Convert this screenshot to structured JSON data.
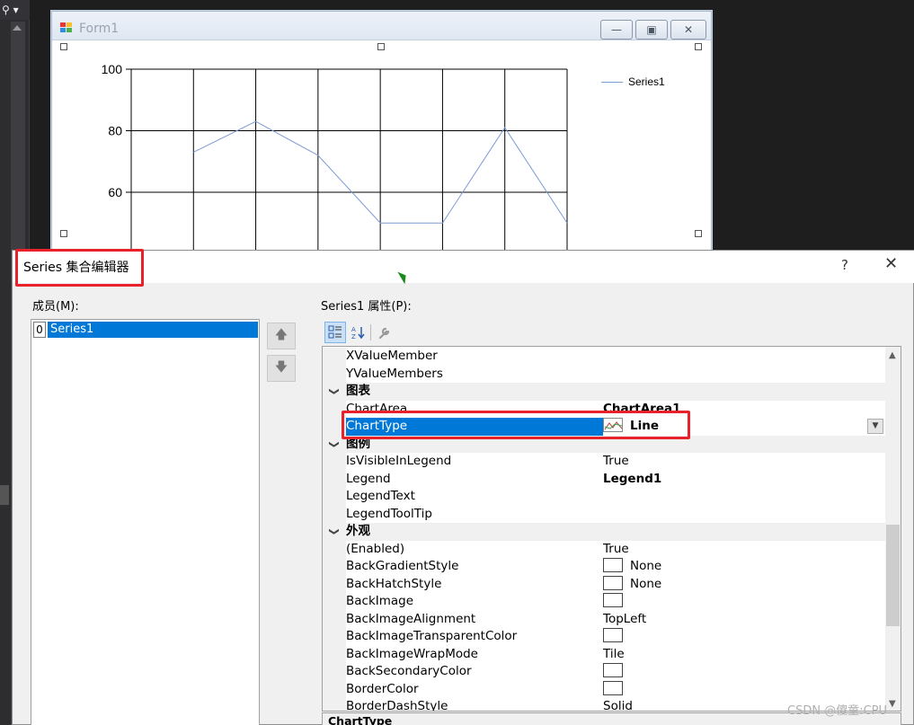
{
  "ide": {
    "top_button": "⚲ ▾"
  },
  "form": {
    "title": "Form1",
    "chart": {
      "y_ticks": [
        "100",
        "80",
        "60"
      ],
      "legend": "Series1"
    }
  },
  "chart_data": {
    "type": "line",
    "series": [
      {
        "name": "Series1",
        "color": "#7d9ad6",
        "values": [
          73,
          83,
          72,
          50,
          50,
          81,
          50
        ]
      }
    ],
    "ylim": [
      50,
      100
    ],
    "grid": true,
    "legend": "top-right"
  },
  "dialog": {
    "title": "Series 集合编辑器",
    "help": "?",
    "close": "✕",
    "members_label": "成员(M):",
    "members": [
      {
        "index": "0",
        "name": "Series1"
      }
    ],
    "move_up": "🡅",
    "move_down": "🡇",
    "props_label": "Series1 属性(P):",
    "toolbar": {
      "categorized": "categorized-icon",
      "alphabetical": "sort-az-icon",
      "property_pages": "wrench-icon"
    },
    "rows": [
      {
        "kind": "prop",
        "name": "XValueMember",
        "value": ""
      },
      {
        "kind": "prop",
        "name": "YValueMembers",
        "value": ""
      },
      {
        "kind": "cat",
        "name": "图表"
      },
      {
        "kind": "prop",
        "name": "ChartArea",
        "value": "ChartArea1",
        "bold": true
      },
      {
        "kind": "prop",
        "name": "ChartType",
        "value": "Line",
        "bold": true,
        "selected": true,
        "icon": "line"
      },
      {
        "kind": "cat",
        "name": "图例"
      },
      {
        "kind": "prop",
        "name": "IsVisibleInLegend",
        "value": "True"
      },
      {
        "kind": "prop",
        "name": "Legend",
        "value": "Legend1",
        "bold": true
      },
      {
        "kind": "prop",
        "name": "LegendText",
        "value": ""
      },
      {
        "kind": "prop",
        "name": "LegendToolTip",
        "value": ""
      },
      {
        "kind": "cat",
        "name": "外观"
      },
      {
        "kind": "prop",
        "name": "(Enabled)",
        "value": "True"
      },
      {
        "kind": "prop",
        "name": "BackGradientStyle",
        "value": "None",
        "icon": "swatch"
      },
      {
        "kind": "prop",
        "name": "BackHatchStyle",
        "value": "None",
        "icon": "swatch"
      },
      {
        "kind": "prop",
        "name": "BackImage",
        "value": "",
        "icon": "swatch"
      },
      {
        "kind": "prop",
        "name": "BackImageAlignment",
        "value": "TopLeft"
      },
      {
        "kind": "prop",
        "name": "BackImageTransparentColor",
        "value": "",
        "icon": "swatch"
      },
      {
        "kind": "prop",
        "name": "BackImageWrapMode",
        "value": "Tile"
      },
      {
        "kind": "prop",
        "name": "BackSecondaryColor",
        "value": "",
        "icon": "swatch"
      },
      {
        "kind": "prop",
        "name": "BorderColor",
        "value": "",
        "icon": "swatch"
      },
      {
        "kind": "prop",
        "name": "BorderDashStyle",
        "value": "Solid"
      }
    ],
    "description_title": "ChartType"
  },
  "watermark": "CSDN @傻童:CPU"
}
